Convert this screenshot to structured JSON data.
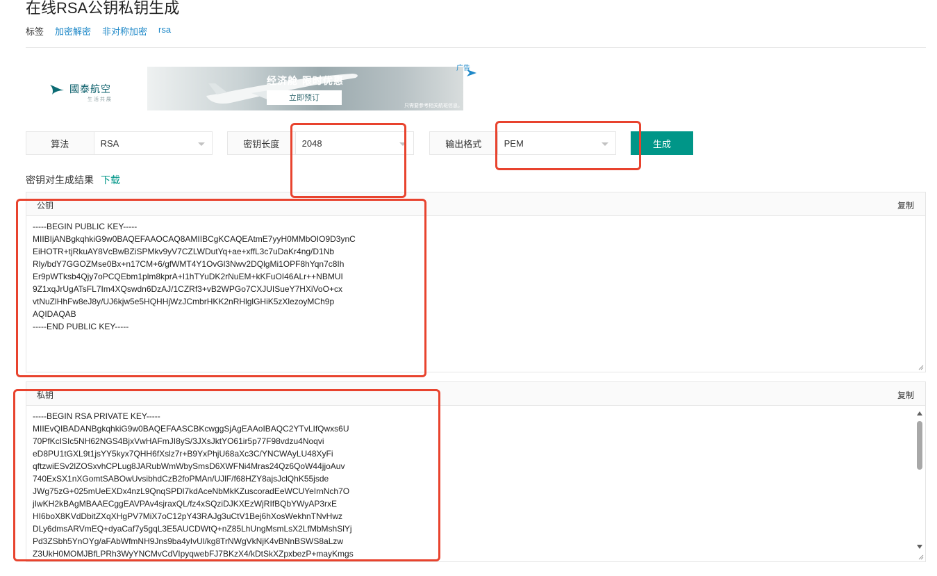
{
  "page": {
    "title": "在线RSA公钥私钥生成",
    "tags_label": "标签",
    "tags": [
      "加密解密",
      "非对称加密",
      "rsa"
    ]
  },
  "ad": {
    "logo_text": "國泰航空",
    "logo_sub": "生 活 共 展",
    "headline": "经济舱 限时优惠",
    "cta": "立即预订",
    "small_text": "只需要参考相关航班信息。",
    "ad_tag": "广告"
  },
  "form": {
    "algorithm": {
      "label": "算法",
      "value": "RSA"
    },
    "key_length": {
      "label": "密钥长度",
      "value": "2048"
    },
    "output_format": {
      "label": "输出格式",
      "value": "PEM"
    },
    "generate_label": "生成"
  },
  "result": {
    "title": "密钥对生成结果",
    "download_label": "下载",
    "public": {
      "title": "公钥",
      "copy_label": "复制",
      "content": "-----BEGIN PUBLIC KEY-----\nMIIBIjANBgkqhkiG9w0BAQEFAAOCAQ8AMIIBCgKCAQEAtmE7yyH0MMbOIO9D3ynC\nEiHOTR+tjRkuAY8VcBwBZiSPMkv9yV7CZLWDutYq+ae+xffL3c7uDaKr4ng/D1Nb\nRly/bdY7GGOZMse0Bx+n17CM+6/gfWMT4Y1OvGl3Nwv2DQlgMi1OPF8hYqn7c8Ih\nEr9pWTksb4Qjy7oPCQEbm1plm8kprA+I1hTYuDK2rNuEM+kKFuOI46ALr++NBMUI\n9Z1xqJrUgATsFL7Im4XQswdn6DzAJ/1CZRf3+vB2WPGo7CXJUISueY7HXiVoO+cx\nvtNuZlHhFw8eJ8y/UJ6kjw5e5HQHHjWzJCmbrHKK2nRHlglGHiK5zXlezoyMCh9p\nAQIDAQAB\n-----END PUBLIC KEY-----"
    },
    "private": {
      "title": "私钥",
      "copy_label": "复制",
      "content": "-----BEGIN RSA PRIVATE KEY-----\nMIIEvQIBADANBgkqhkiG9w0BAQEFAASCBKcwggSjAgEAAoIBAQC2YTvLIfQwxs6U\n70PfKcISIc5NH62NGS4BjxVwHAFmJI8yS/3JXsJktYO61ir5p77F98vdzu4Noqvi\neD8PU1tGXL9t1jsYY5kyx7QHH6fXslz7r+B9YxPhjU68aXc3C/YNCWAyLU48XyFi\nqftzwiESv2lZOSxvhCPLug8JARubWmWbySmsD6XWFNi4Mras24Qz6QoW44jjoAuv\n740ExSX1nXGomtSABOwUvsibhdCzB2foPMAn/UJlF/f68HZY8ajsJclQhK55jsde\nJWg75zG+025mUeEXDx4nzL9QnqSPDl7kdAceNbMkKZuscoradEeWCUYeIrnNch7O\njIwKH2kBAgMBAAECggEAVPAv4sjraxQL/fz4xSQziDJKXEzWjRIfBQbYWyAP3rxE\nHI6boX8KVdDbitZXqXHgPV7MiX7oC12pY43RAJg3uCtV1Bej6hXosWekhnTNvHwz\nDLy6dmsARVmEQ+dyaCaf7y5gqL3E5AUCDWtQ+nZ85LhUngMsmLsX2LfMbMshSlYj\nPd3ZSbh5YnOYg/aFAbWfmNH9Jns9ba4yIvUl/kg8TrNWgVkNjK4vBNnBSWS8aLzw\nZ3UkH0MOMJBfLPRh3WyYNCMvCdVIpyqwebFJ7BKzX4/kDtSkXZpxbezP+mayKmgs"
    }
  }
}
